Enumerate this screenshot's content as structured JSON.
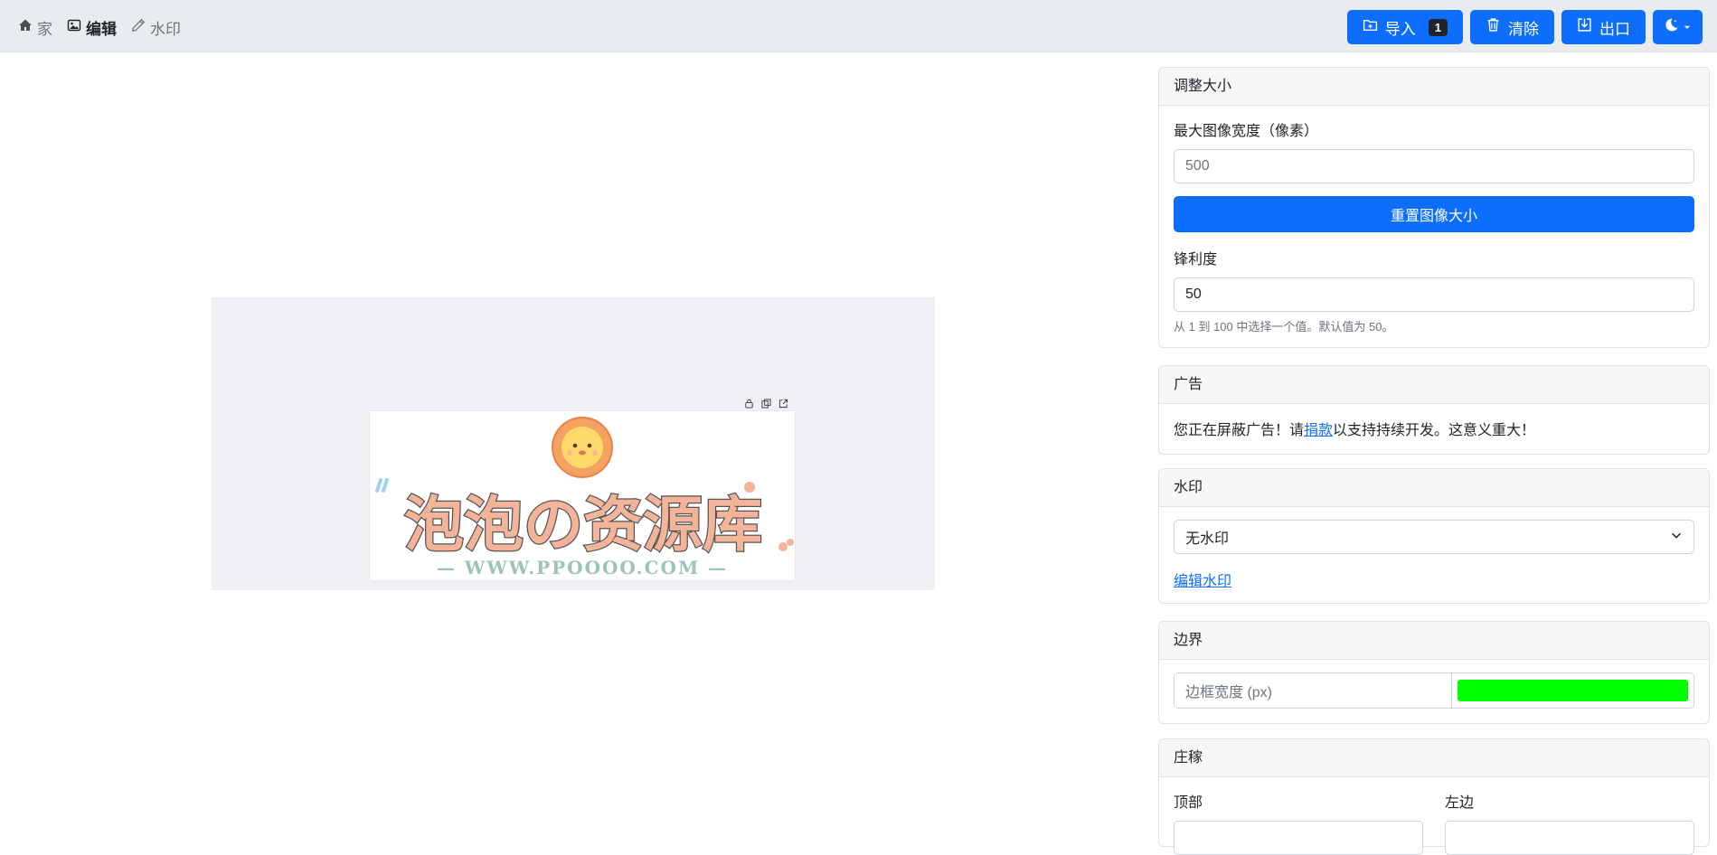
{
  "nav": {
    "links": [
      {
        "label": "家",
        "icon": "house-icon"
      },
      {
        "label": "编辑",
        "icon": "image-icon"
      },
      {
        "label": "水印",
        "icon": "pencil-icon"
      }
    ],
    "actions": {
      "import_label": "导入",
      "import_count": "1",
      "clear_label": "清除",
      "export_label": "出口",
      "theme_icon": "moon-icon"
    }
  },
  "canvas": {
    "toolbar_icons": [
      "lock-icon",
      "copy-icon",
      "open-external-icon"
    ],
    "image": {
      "title_text": "泡泡の资源库",
      "url_text": "— WWW.PPOOOO.COM —"
    }
  },
  "sidebar": {
    "resize": {
      "header": "调整大小",
      "max_width_label": "最大图像宽度（像素）",
      "max_width_placeholder": "500",
      "reset_button": "重置图像大小",
      "sharpness_label": "锋利度",
      "sharpness_value": "50",
      "sharpness_help": "从 1 到 100 中选择一个值。默认值为 50。"
    },
    "ads": {
      "header": "广告",
      "text_before": "您正在屏蔽广告！请",
      "donate_link": "捐款",
      "text_after": "以支持持续开发。这意义重大！"
    },
    "watermark": {
      "header": "水印",
      "selected": "无水印",
      "edit_link": "编辑水印"
    },
    "border": {
      "header": "边界",
      "width_placeholder": "边框宽度 (px)",
      "color": "#00ff00"
    },
    "padding": {
      "header": "庄稼",
      "top_label": "顶部",
      "left_label": "左边"
    }
  },
  "colors": {
    "accent": "#0d6efd",
    "nav_bg": "#e9ecef",
    "canvas_bg": "#eff0f3"
  }
}
